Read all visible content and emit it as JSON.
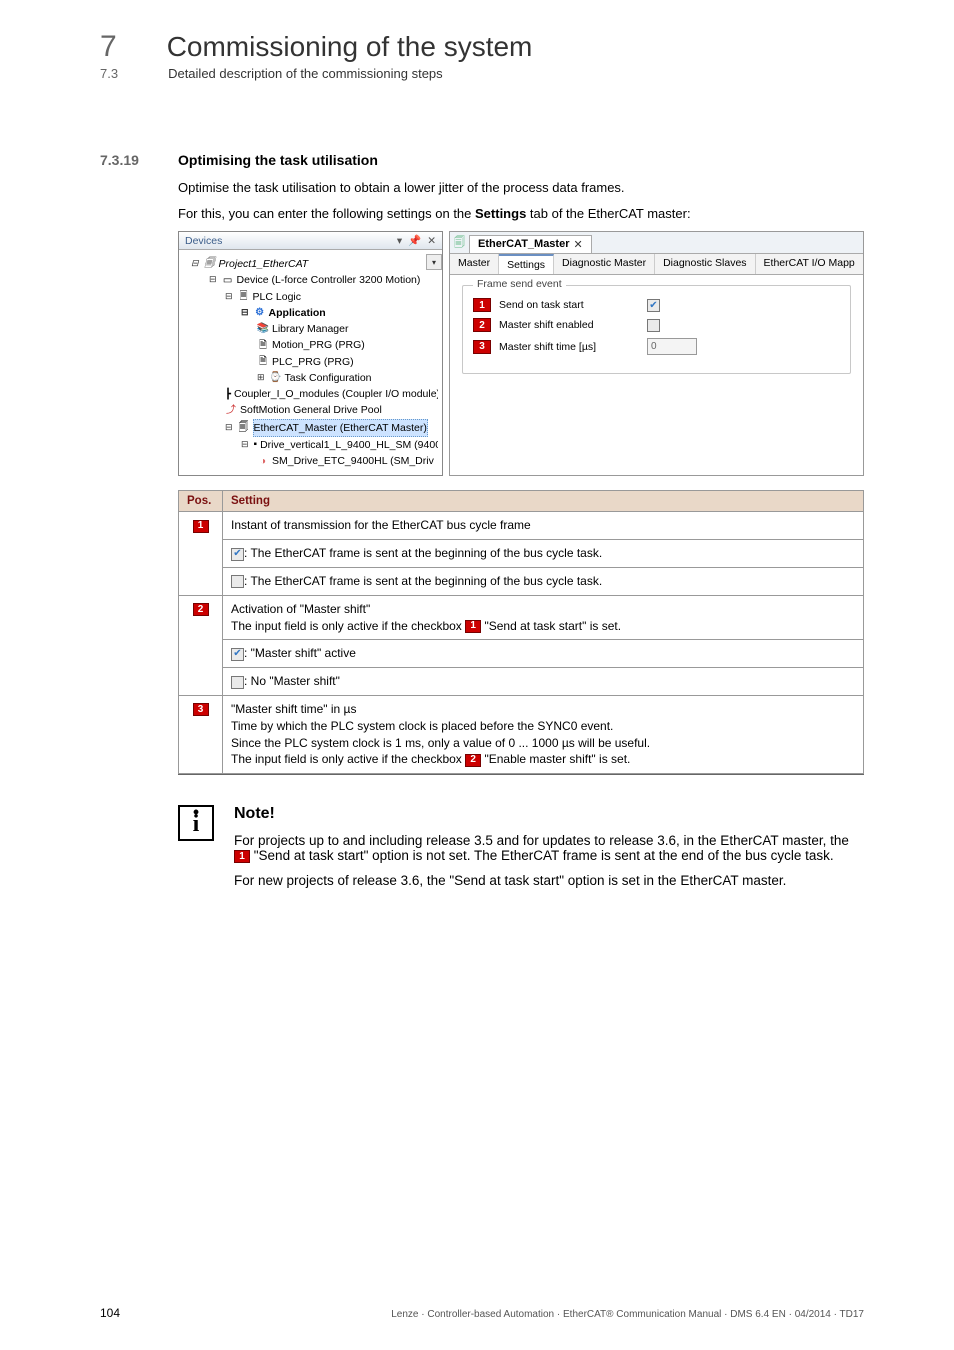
{
  "header": {
    "chapter_number": "7",
    "chapter_title": "Commissioning of the system",
    "section_number": "7.3",
    "section_title": "Detailed description of the commissioning steps",
    "dash_rule": "_ _ _ _ _ _ _ _ _ _ _ _ _ _ _ _ _ _ _ _ _ _ _ _ _ _ _ _ _ _ _ _ _ _ _ _ _ _ _ _ _ _ _ _ _ _ _ _ _ _ _ _ _ _ _ _ _ _ _ _ _ _ _ _"
  },
  "subsection": {
    "number": "7.3.19",
    "title": "Optimising the task utilisation"
  },
  "body": {
    "p1": "Optimise the task utilisation to obtain a lower jitter of the process data frames.",
    "p2a": "For this, you can enter the following settings on the ",
    "p2b": "Settings",
    "p2c": " tab of the EtherCAT master:"
  },
  "devices": {
    "title": "Devices",
    "items": {
      "project": "Project1_EtherCAT",
      "device": "Device (L-force Controller 3200 Motion)",
      "plc_logic": "PLC Logic",
      "application": "Application",
      "library_manager": "Library Manager",
      "motion_prg": "Motion_PRG (PRG)",
      "plc_prg": "PLC_PRG (PRG)",
      "task_config": "Task Configuration",
      "coupler": "Coupler_I_O_modules (Coupler I/O module)",
      "sm_pool": "SoftMotion General Drive Pool",
      "ec_master": "EtherCAT_Master (EtherCAT Master)",
      "drive": "Drive_vertical1_L_9400_HL_SM (9400 I",
      "sm_drive": "SM_Drive_ETC_9400HL (SM_Driv"
    }
  },
  "editor": {
    "file_tab": "EtherCAT_Master",
    "tabs": {
      "master": "Master",
      "settings": "Settings",
      "diag_master": "Diagnostic Master",
      "diag_slaves": "Diagnostic Slaves",
      "io_map": "EtherCAT I/O Mapp"
    },
    "group_title": "Frame send event",
    "rows": {
      "r1": {
        "label": "Send on task start"
      },
      "r2": {
        "label": "Master shift enabled"
      },
      "r3": {
        "label": "Master shift time [µs]",
        "value": "0"
      }
    }
  },
  "table": {
    "hdr_pos": "Pos.",
    "hdr_setting": "Setting",
    "r1": {
      "l1": "Instant of transmission for the EtherCAT bus cycle frame",
      "l2": ": The EtherCAT frame is sent at the beginning of the bus cycle task.",
      "l3": ": The EtherCAT frame is sent at the beginning of the bus cycle task."
    },
    "r2": {
      "l1a": "Activation of \"Master shift\"",
      "l1b_pre": "The input field is only active if the checkbox ",
      "l1b_post": " \"Send at task start\" is set.",
      "l2": ": \"Master shift\" active",
      "l3": ": No \"Master shift\""
    },
    "r3": {
      "l1": "\"Master shift time\" in µs",
      "l2": "Time by which the PLC system clock is placed before the SYNC0 event.",
      "l3": "Since the PLC system clock is 1 ms, only a value of 0 ... 1000 µs will be useful.",
      "l4_pre": "The input field is only active if the checkbox ",
      "l4_post": " \"Enable master shift\" is set."
    }
  },
  "note": {
    "title": "Note!",
    "p1_pre": "For projects up to and including release 3.5 and for updates to release 3.6, in the EtherCAT master, the ",
    "p1_post": " \"Send at task start\" option is not set. The EtherCAT frame is sent at the end of the bus cycle task.",
    "p2": "For new projects of release 3.6, the \"Send at task start\" option is set in the EtherCAT master."
  },
  "footer": {
    "page": "104",
    "text": "Lenze · Controller-based Automation · EtherCAT® Communication Manual · DMS 6.4 EN · 04/2014 · TD17"
  }
}
